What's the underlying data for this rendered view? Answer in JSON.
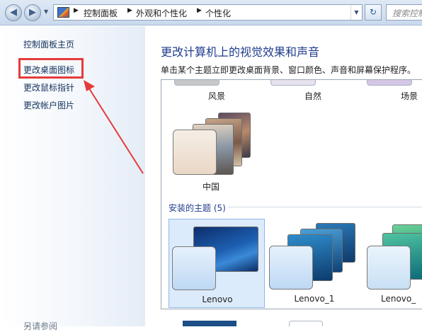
{
  "address_bar": {
    "breadcrumb": [
      "控制面板",
      "外观和个性化",
      "个性化"
    ],
    "search_placeholder": "搜索控制"
  },
  "left_pane": {
    "links": [
      "控制面板主页",
      "更改桌面图标",
      "更改鼠标指针",
      "更改帐户图片"
    ],
    "highlighted_link": "更改桌面图标",
    "highlight_color": "#e53b3b",
    "see_also": "另请参阅"
  },
  "main": {
    "heading": "更改计算机上的视觉效果和声音",
    "subtext": "单击某个主题立即更改桌面背景、窗口颜色、声音和屏幕保护程序。",
    "aero_themes": [
      "风景",
      "自然",
      "场景",
      "中国"
    ],
    "installed_section": "安装的主题 (5)",
    "installed_themes": [
      "Lenovo",
      "Lenovo_1",
      "Lenovo_"
    ],
    "selected_theme": "Lenovo"
  }
}
